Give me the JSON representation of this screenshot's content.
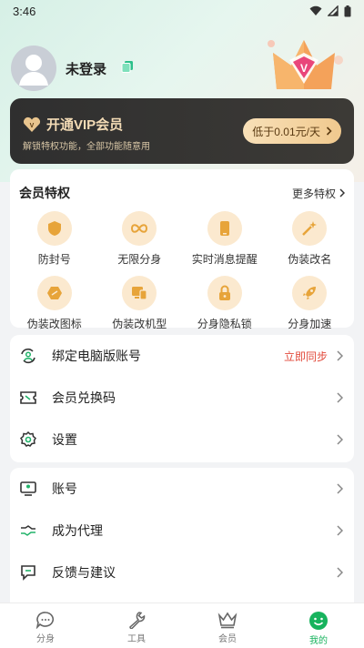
{
  "status_bar": {
    "time": "3:46"
  },
  "profile": {
    "username": "未登录"
  },
  "vip_banner": {
    "title": "开通VIP会员",
    "subtitle": "解锁特权功能，全部功能随意用",
    "price_button": "低于0.01元/天"
  },
  "perks": {
    "title": "会员特权",
    "more_label": "更多特权",
    "items": [
      {
        "label": "防封号",
        "icon": "shield-icon"
      },
      {
        "label": "无限分身",
        "icon": "infinity-icon"
      },
      {
        "label": "实时消息提醒",
        "icon": "phone-vibrate-icon"
      },
      {
        "label": "伪装改名",
        "icon": "magic-wand-icon"
      },
      {
        "label": "伪装改图标",
        "icon": "hexagon-icon"
      },
      {
        "label": "伪装改机型",
        "icon": "device-icon"
      },
      {
        "label": "分身隐私锁",
        "icon": "lock-icon"
      },
      {
        "label": "分身加速",
        "icon": "rocket-icon"
      }
    ]
  },
  "menu1": {
    "items": [
      {
        "label": "绑定电脑版账号",
        "extra": "立即同步",
        "icon": "sync-user-icon"
      },
      {
        "label": "会员兑换码",
        "extra": "",
        "icon": "ticket-icon"
      },
      {
        "label": "设置",
        "extra": "",
        "icon": "gear-icon"
      }
    ]
  },
  "menu2": {
    "items": [
      {
        "label": "账号",
        "icon": "account-icon"
      },
      {
        "label": "成为代理",
        "icon": "handshake-icon"
      },
      {
        "label": "反馈与建议",
        "icon": "feedback-icon"
      }
    ]
  },
  "tabbar": {
    "tabs": [
      {
        "label": "分身",
        "icon": "chat-bubble-icon",
        "active": false
      },
      {
        "label": "工具",
        "icon": "wrench-icon",
        "active": false
      },
      {
        "label": "会员",
        "icon": "crown-icon",
        "active": false
      },
      {
        "label": "我的",
        "icon": "smile-icon",
        "active": true
      }
    ]
  },
  "colors": {
    "accent_green": "#17b35d",
    "vip_gold": "#f0c98e",
    "highlight_red": "#e24a3b",
    "perk_bg": "#fbe9cf"
  }
}
